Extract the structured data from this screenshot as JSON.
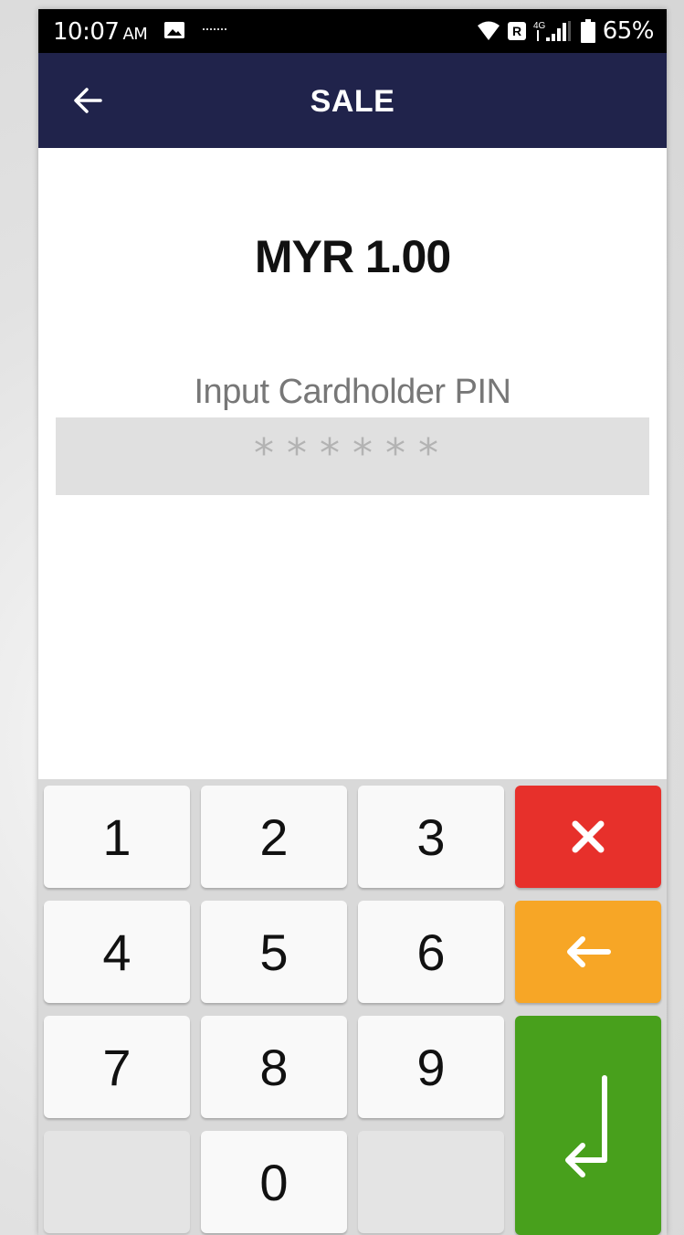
{
  "status_bar": {
    "time": "10:07",
    "ampm": "AM",
    "network_badge": "R",
    "network_type": "4G",
    "battery_percent": "65%",
    "icons": [
      "gallery-icon",
      "app-notification-icon",
      "wifi-icon",
      "roaming-icon",
      "signal-icon",
      "battery-icon"
    ]
  },
  "app_bar": {
    "title": "SALE",
    "back_icon": "back-arrow-icon"
  },
  "transaction": {
    "amount": "MYR 1.00",
    "pin_label": "Input Cardholder PIN",
    "pin_mask": "******"
  },
  "keypad": {
    "keys": [
      "1",
      "2",
      "3",
      "4",
      "5",
      "6",
      "7",
      "8",
      "9",
      "0"
    ],
    "cancel_icon": "cancel-x-icon",
    "clear_icon": "backspace-arrow-icon",
    "enter_icon": "enter-return-icon",
    "colors": {
      "cancel": "#e7302b",
      "clear": "#f7a626",
      "enter": "#48a01c"
    }
  },
  "colors": {
    "app_bar": "#20234b",
    "status_bar": "#000000"
  }
}
